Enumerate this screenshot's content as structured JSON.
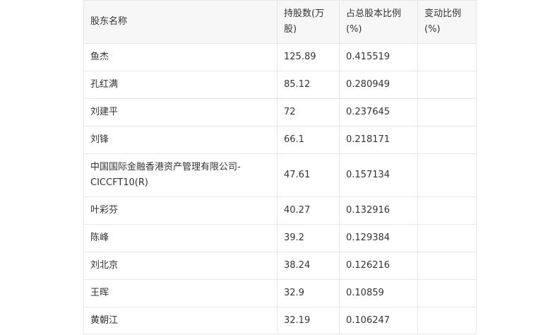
{
  "table": {
    "headers": [
      "股东名称",
      "持股数(万股)",
      "占总股本比例(%)",
      "变动比例(%)"
    ],
    "rows": [
      {
        "name": "鱼杰",
        "shares": "125.89",
        "ratio": "0.415519",
        "change": ""
      },
      {
        "name": "孔红满",
        "shares": "85.12",
        "ratio": "0.280949",
        "change": ""
      },
      {
        "name": "刘建平",
        "shares": "72",
        "ratio": "0.237645",
        "change": ""
      },
      {
        "name": "刘锋",
        "shares": "66.1",
        "ratio": "0.218171",
        "change": ""
      },
      {
        "name": "中国国际金融香港资产管理有限公司-CICCFT10(R)",
        "shares": "47.61",
        "ratio": "0.157134",
        "change": ""
      },
      {
        "name": "叶彩芬",
        "shares": "40.27",
        "ratio": "0.132916",
        "change": ""
      },
      {
        "name": "陈峰",
        "shares": "39.2",
        "ratio": "0.129384",
        "change": ""
      },
      {
        "name": "刘北京",
        "shares": "38.24",
        "ratio": "0.126216",
        "change": ""
      },
      {
        "name": "王晖",
        "shares": "32.9",
        "ratio": "0.10859",
        "change": ""
      },
      {
        "name": "黄朝江",
        "shares": "32.19",
        "ratio": "0.106247",
        "change": ""
      }
    ]
  }
}
